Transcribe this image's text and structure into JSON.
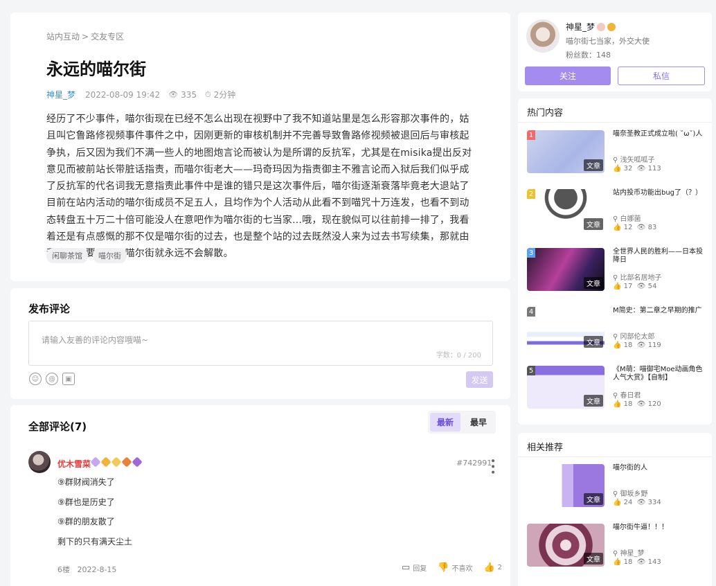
{
  "article": {
    "breadcrumb": [
      "站内互动",
      "交友专区"
    ],
    "breadcrumb_sep": ">",
    "title": "永远的喵尔街",
    "author": "神星_梦",
    "date": "2022-08-09 19:42",
    "views": "335",
    "read_time": "2分钟",
    "body": "经历了不少事件，喵尔街现在已经不怎么出现在视野中了我不知道站里是怎么形容那次事件的，姑且叫它鲁路修视频事件事件之中，因刚更新的审核机制并不完善导致鲁路修视频被退回后与审核起争执，后又因为我们不满一些人的地图炮言论而被认为是所谓的反抗军，尤其是在misika提出反对意见而被前站长带脏话指责，而喵尔街老大——玛奇玛因为指责御主不雅言论而入狱后我们似乎成了反抗军的代名词我无意指责此事件中是谁的错只是这次事件后，喵尔街逐渐衰落毕竟老大退站了目前在站内活动的喵尔街成员不足五人，且均作为个人活动从此看不到喵咒十万连发，也看不到动态转盘五十万二十倍可能没人在意吧作为喵尔街的七当家…哦，现在貌似可以往前排一排了，我看着还是有点感慨的那不仅是喵尔街的过去，也是整个站的过去既然没人来为过去书写续集，那就由我来。只要我在，喵尔街就永远不会解散。",
    "tags": [
      "闲聊茶馆",
      "喵尔街"
    ]
  },
  "compose": {
    "title": "发布评论",
    "placeholder": "请输入友善的评论内容哦喵~",
    "counter": "字数：0 / 200",
    "send_label": "发送"
  },
  "comments": {
    "title": "全部评论(7)",
    "sort_newest": "最新",
    "sort_oldest": "最早",
    "first": {
      "user": "优木雪菜",
      "id": "#742991",
      "lines": [
        "⑨群财阀消失了",
        "⑨群也是历史了",
        "⑨群的朋友散了",
        "剩下的只有满天尘土"
      ],
      "floor": "6楼",
      "date": "2022-8-15",
      "reply_label": "回复",
      "dislike_label": "不喜欢",
      "likes": "2",
      "badge_colors": [
        "#c8a6f0",
        "#f2b33a",
        "#f3c95a",
        "#e9803c",
        "#a267d6"
      ]
    }
  },
  "author_card": {
    "name": "神星_梦",
    "desc": "喵尔街七当家，外交大使",
    "fans": "粉丝数：148",
    "follow_label": "关注",
    "message_label": "私信"
  },
  "hot": {
    "title": "热门内容",
    "items": [
      {
        "rank": "1",
        "rank_color": "#f06a6a",
        "title": "喵奈圣教正式成立啦( ˘ω˘)人",
        "author": "浅矢呱呱子",
        "likes": "32",
        "views": "113",
        "label": "文章",
        "thumb": "linear-gradient(135deg,#cfd4ee,#a9b6e6 60%,#c8cdf0)"
      },
      {
        "rank": "2",
        "rank_color": "#f2c02c",
        "title": "站内投币功能出bug了（？）",
        "author": "白娜菌",
        "likes": "12",
        "views": "83",
        "label": "文章",
        "thumb": "radial-gradient(circle at 50% 20%,#555 0 22%,#fff 23% 33%,#555 34% 40%,#fff 41%)"
      },
      {
        "rank": "3",
        "rank_color": "#5aa0f0",
        "title": "全世界人民的胜利——日本投降日",
        "author": "比部名居地子",
        "likes": "17",
        "views": "54",
        "label": "文章",
        "thumb": "linear-gradient(120deg,#2a1630,#b5409a 45%,#3a2260 70%,#120c18)"
      },
      {
        "rank": "4",
        "rank_color": "#777",
        "title": "M简史：第二章之早期的推广",
        "author": "冈部伦太郎",
        "likes": "18",
        "views": "119",
        "label": "文章",
        "thumb": "linear-gradient(#fff 0 58%,#e8f0ff 58% 70%,#fff 70% 80%,#7b6be0 80% 88%,#fff 88%)"
      },
      {
        "rank": "5",
        "rank_color": "#555",
        "title": "《M萌：喵御宅Moe动画角色人气大赏》【自制】",
        "author": "春日君",
        "likes": "18",
        "views": "120",
        "label": "文章",
        "thumb": "linear-gradient(#8a6fe0 0 22%,#efeafb 22%)"
      }
    ]
  },
  "rec": {
    "title": "相关推荐",
    "items": [
      {
        "title": "喵尔街的人",
        "author": "御坂乡野",
        "likes": "24",
        "views": "334",
        "label": "文章",
        "thumb": "linear-gradient(90deg,#fff 0 45%,#c9b3f0 45% 60%,#9a78e0 60%)"
      },
      {
        "title": "喵尔街牛逼！！！",
        "author": "神星_梦",
        "likes": "18",
        "views": "143",
        "label": "文章",
        "thumb": "radial-gradient(circle at 50% 50%,#f3dfe6 0 12%,#8a3e5e 13% 30%,#e8d3dc 31% 45%,#7a3452 46% 60%,#cfa6b8 61%)"
      }
    ]
  },
  "colors": {
    "accent": "#a38bf0",
    "link": "#3b8fe0",
    "username_red": "#e23d3d"
  }
}
